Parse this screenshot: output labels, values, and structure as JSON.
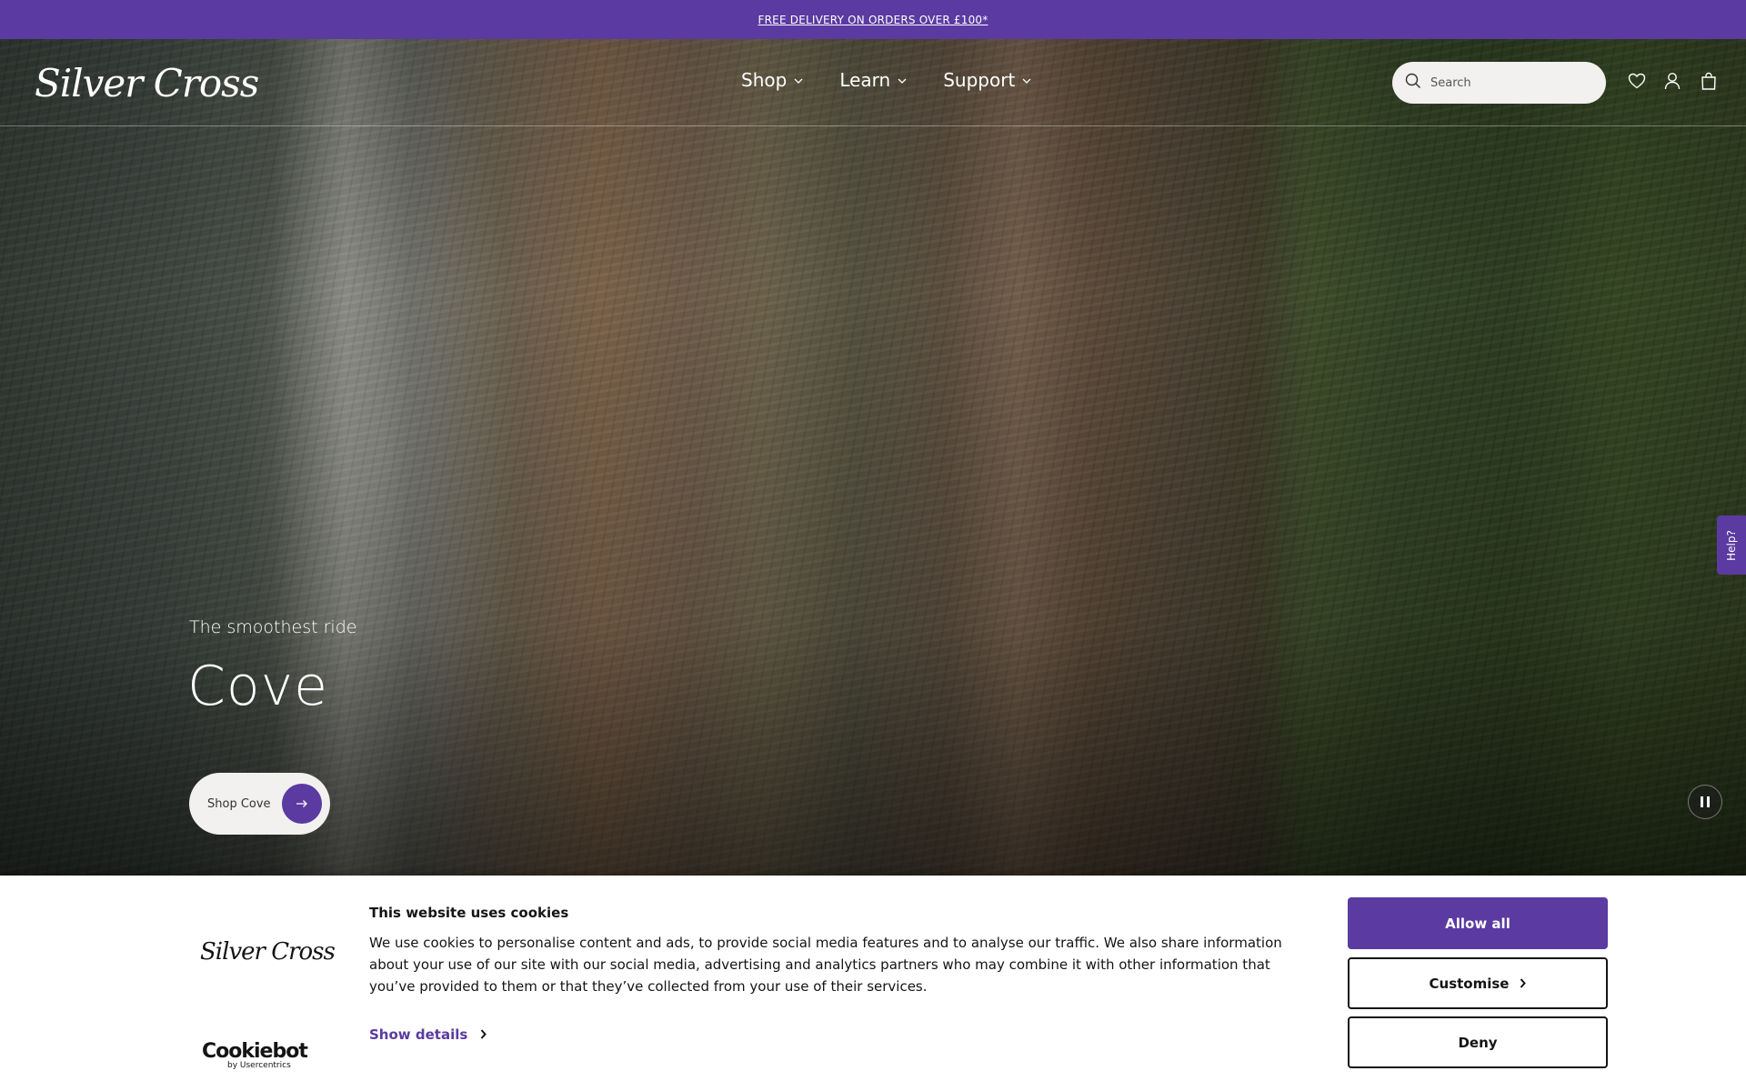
{
  "announcement": {
    "text": "FREE DELIVERY ON ORDERS OVER £100*"
  },
  "header": {
    "logo_text": "Silver Cross",
    "nav": [
      {
        "label": "Shop"
      },
      {
        "label": "Learn"
      },
      {
        "label": "Support"
      }
    ],
    "search": {
      "placeholder": "Search"
    },
    "icons": [
      "wishlist-heart-icon",
      "account-user-icon",
      "cart-bag-icon"
    ]
  },
  "hero": {
    "eyebrow": "The smoothest ride",
    "title": "Cove",
    "cta_label": "Shop Cove"
  },
  "help_tab": {
    "label": "Help?"
  },
  "cookie_banner": {
    "logo_text": "Silver Cross",
    "provider": "Cookiebot",
    "provider_sub": "by Usercentrics",
    "title": "This website uses cookies",
    "body": "We use cookies to personalise content and ads, to provide social media features and to analyse our traffic. We also share information about your use of our site with our social media, advertising and analytics partners who may combine it with other information that you’ve provided to them or that they’ve collected from your use of their services.",
    "show_details": "Show details",
    "buttons": {
      "allow": "Allow all",
      "customise": "Customise",
      "deny": "Deny"
    }
  },
  "colors": {
    "brand_purple": "#5b3aa1",
    "white": "#ffffff",
    "text_dark": "#141414"
  }
}
